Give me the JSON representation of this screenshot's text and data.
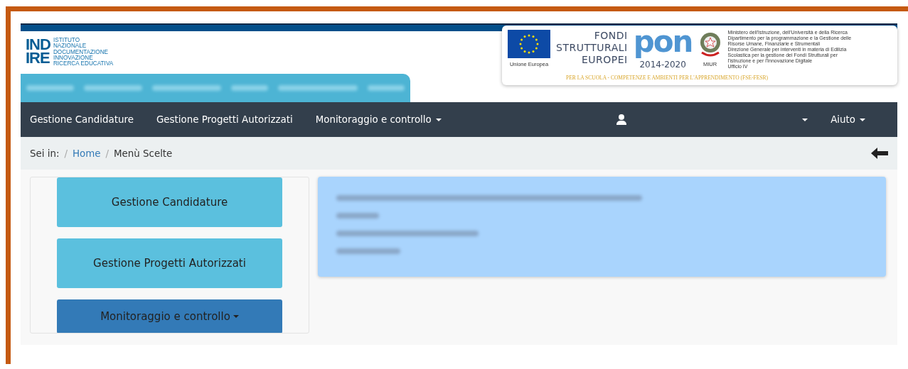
{
  "logo": {
    "mark_lines": [
      "IND",
      "IRE"
    ],
    "name_lines": [
      "ISTITUTO",
      "NAZIONALE",
      "DOCUMENTAZIONE",
      "INNOVAZIONE",
      "RICERCA EDUCATIVA"
    ]
  },
  "banner": {
    "eu_caption": "Unione Europea",
    "fondi_lines": [
      "FONDI",
      "STRUTTURALI",
      "EUROPEI"
    ],
    "pon": "pon",
    "pon_years": "2014-2020",
    "motto": "PER LA SCUOLA - COMPETENZE E AMBIENTI PER L'APPRENDIMENTO (FSE-FESR)",
    "miur_caption": "MIUR",
    "ministry_lines": [
      "Ministero dell'Istruzione, dell'Università e della Ricerca",
      "Dipartimento per la programmazione e la Gestione delle",
      "Risorse Umane, Finanziarie e Strumentali",
      "Direzione Generale per interventi in materia di Edilizia",
      "Scolastica per la gestione dei Fondi Strutturali per",
      "l'istruzione e per l'Innovazione Digitale",
      "Ufficio IV"
    ]
  },
  "navbar": {
    "items": [
      {
        "label": "Gestione Candidature",
        "kind": "link"
      },
      {
        "label": "Gestione Progetti Autorizzati",
        "kind": "link"
      },
      {
        "label": "Monitoraggio e controllo",
        "kind": "dropdown"
      }
    ],
    "right": [
      {
        "kind": "user"
      },
      {
        "label": "Aiuto",
        "kind": "dropdown"
      }
    ]
  },
  "breadcrumb": {
    "prefix": "Sei in:",
    "separator": "/",
    "items": [
      {
        "label": "Home",
        "kind": "link"
      },
      {
        "label": "Menù Scelte",
        "kind": "current"
      }
    ]
  },
  "menu": {
    "buttons": [
      {
        "label": "Gestione Candidature",
        "kind": "info"
      },
      {
        "label": "Gestione Progetti Autorizzati",
        "kind": "info"
      },
      {
        "label": "Monitoraggio e controllo",
        "kind": "primary",
        "dropdown": true
      }
    ]
  }
}
